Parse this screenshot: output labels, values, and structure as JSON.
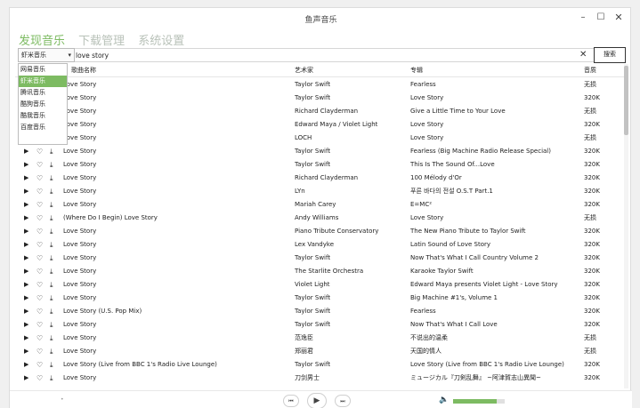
{
  "window": {
    "title": "鱼声音乐",
    "min_icon": "minimize-icon",
    "max_icon": "maximize-icon",
    "close_icon": "close-icon"
  },
  "tabs": [
    {
      "label": "发现音乐",
      "active": true
    },
    {
      "label": "下载管理",
      "active": false
    },
    {
      "label": "系统设置",
      "active": false
    }
  ],
  "search": {
    "source_selected": "虾米音乐",
    "query": "love story",
    "clear_label": "✕",
    "button_label": "搜索"
  },
  "dropdown": {
    "options": [
      "网易音乐",
      "虾米音乐",
      "腾讯音乐",
      "酷狗音乐",
      "酷我音乐",
      "百度音乐"
    ],
    "selected_index": 1
  },
  "table": {
    "headers": {
      "title": "歌曲名称",
      "artist": "艺术家",
      "album": "专辑",
      "quality": "音质"
    },
    "rows": [
      {
        "title": "Love Story",
        "artist": "Taylor Swift",
        "album": "Fearless",
        "quality": "无损"
      },
      {
        "title": "Love Story",
        "artist": "Taylor Swift",
        "album": "Love Story",
        "quality": "320K"
      },
      {
        "title": "Love Story",
        "artist": "Richard Clayderman",
        "album": "Give a Little Time to Your Love",
        "quality": "无损"
      },
      {
        "title": "Love Story",
        "artist": "Edward Maya / Violet Light",
        "album": "Love Story",
        "quality": "320K"
      },
      {
        "title": "Love Story",
        "artist": "LOCH",
        "album": "Love Story",
        "quality": "无损"
      },
      {
        "title": "Love Story",
        "artist": "Taylor Swift",
        "album": "Fearless (Big Machine Radio Release Special)",
        "quality": "320K"
      },
      {
        "title": "Love Story",
        "artist": "Taylor Swift",
        "album": "This Is The Sound Of...Love",
        "quality": "320K"
      },
      {
        "title": "Love Story",
        "artist": "Richard Clayderman",
        "album": "100 Mélody d'Or",
        "quality": "320K"
      },
      {
        "title": "Love Story",
        "artist": "LYn",
        "album": "푸른 바다의 전설 O.S.T Part.1",
        "quality": "320K"
      },
      {
        "title": "Love Story",
        "artist": "Mariah Carey",
        "album": "E=MC²",
        "quality": "320K"
      },
      {
        "title": "(Where Do I Begin) Love Story",
        "artist": "Andy Williams",
        "album": "Love Story",
        "quality": "无损"
      },
      {
        "title": "Love Story",
        "artist": "Piano Tribute Conservatory",
        "album": "The New Piano Tribute to Taylor Swift",
        "quality": "320K"
      },
      {
        "title": "Love Story",
        "artist": "Lex Vandyke",
        "album": "Latin Sound of Love Story",
        "quality": "320K"
      },
      {
        "title": "Love Story",
        "artist": "Taylor Swift",
        "album": "Now That's What I Call Country Volume 2",
        "quality": "320K"
      },
      {
        "title": "Love Story",
        "artist": "The Starlite Orchestra",
        "album": "Karaoke Taylor Swift",
        "quality": "320K"
      },
      {
        "title": "Love Story",
        "artist": "Violet Light",
        "album": "Edward Maya presents Violet Light - Love Story",
        "quality": "320K"
      },
      {
        "title": "Love Story",
        "artist": "Taylor Swift",
        "album": "Big Machine #1's, Volume 1",
        "quality": "320K"
      },
      {
        "title": "Love Story (U.S. Pop Mix)",
        "artist": "Taylor Swift",
        "album": "Fearless",
        "quality": "320K"
      },
      {
        "title": "Love Story",
        "artist": "Taylor Swift",
        "album": "Now That's What I Call Love",
        "quality": "320K"
      },
      {
        "title": "Love Story",
        "artist": "范逸臣",
        "album": "不说出的温柔",
        "quality": "无损"
      },
      {
        "title": "Love Story",
        "artist": "郑丽君",
        "album": "天国的情人",
        "quality": "无损"
      },
      {
        "title": "Love Story (Live from BBC 1's Radio Live Lounge)",
        "artist": "Taylor Swift",
        "album": "Love Story (Live from BBC 1's Radio Live Lounge)",
        "quality": "320K"
      },
      {
        "title": "Love Story",
        "artist": "刀剑男士",
        "album": "ミュージカル『刀剣乱舞』 ~阿津賀志山異聞~",
        "quality": "320K"
      }
    ]
  },
  "player": {
    "prev_label": "⏮",
    "play_label": "▶",
    "next_label": "⏭",
    "volume_icon": "speaker-icon",
    "volume_level": 0.85
  },
  "colors": {
    "accent": "#7dbb62"
  }
}
